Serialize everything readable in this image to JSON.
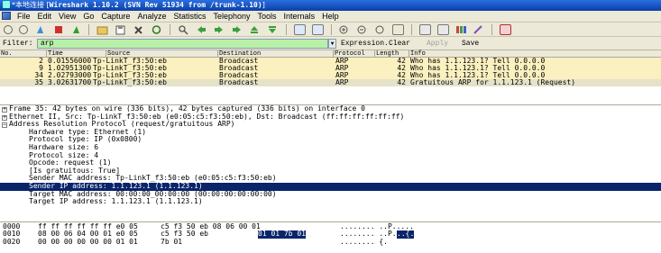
{
  "window": {
    "title": "Wireshark 1.10.2 (SVN Rev 51934 from /trunk-1.10)",
    "prefix": "*本地连接"
  },
  "menu": [
    "File",
    "Edit",
    "View",
    "Go",
    "Capture",
    "Analyze",
    "Statistics",
    "Telephony",
    "Tools",
    "Internals",
    "Help"
  ],
  "toolbar": {
    "icons": [
      "interface-list-icon",
      "capture-options-icon",
      "start-capture-icon",
      "stop-capture-icon",
      "restart-capture-icon",
      "open-file-icon",
      "save-file-icon",
      "close-file-icon",
      "reload-icon",
      "find-packet-icon",
      "go-back-icon",
      "go-forward-icon",
      "go-to-packet-icon",
      "go-first-icon",
      "go-last-icon",
      "colorize-icon",
      "auto-scroll-icon",
      "zoom-in-icon",
      "zoom-out-icon",
      "zoom-normal-icon",
      "resize-columns-icon",
      "capture-filters-icon",
      "display-filters-icon",
      "coloring-rules-icon",
      "preferences-icon",
      "help-icon"
    ]
  },
  "filter": {
    "label": "Filter:",
    "value": "arp",
    "expression": "Expression...",
    "clear": "Clear",
    "apply": "Apply",
    "save": "Save"
  },
  "packet_list": {
    "columns": [
      "No.",
      "Time",
      "Source",
      "Destination",
      "Protocol",
      "Length",
      "Info"
    ],
    "rows": [
      {
        "no": "2",
        "time": "0.01556000",
        "source": "Tp-LinkT_f3:50:eb",
        "destination": "Broadcast",
        "protocol": "ARP",
        "length": "42",
        "info": "Who has 1.1.123.1?  Tell 0.0.0.0"
      },
      {
        "no": "9",
        "time": "1.02951300",
        "source": "Tp-LinkT_f3:50:eb",
        "destination": "Broadcast",
        "protocol": "ARP",
        "length": "42",
        "info": "Who has 1.1.123.1?  Tell 0.0.0.0"
      },
      {
        "no": "34",
        "time": "2.02793000",
        "source": "Tp-LinkT_f3:50:eb",
        "destination": "Broadcast",
        "protocol": "ARP",
        "length": "42",
        "info": "Who has 1.1.123.1?  Tell 0.0.0.0"
      },
      {
        "no": "35",
        "time": "3.02631700",
        "source": "Tp-LinkT_f3:50:eb",
        "destination": "Broadcast",
        "protocol": "ARP",
        "length": "42",
        "info": "Gratuitous ARP for 1.1.123.1 (Request)"
      }
    ]
  },
  "details": {
    "frame": "Frame 35: 42 bytes on wire (336 bits), 42 bytes captured (336 bits) on interface 0",
    "ethernet": "Ethernet II, Src: Tp-LinkT_f3:50:eb (e0:05:c5:f3:50:eb), Dst: Broadcast (ff:ff:ff:ff:ff:ff)",
    "arp": "Address Resolution Protocol (request/gratuitous ARP)",
    "arp_fields": [
      "Hardware type: Ethernet (1)",
      "Protocol type: IP (0x0800)",
      "Hardware size: 6",
      "Protocol size: 4",
      "Opcode: request (1)",
      "[Is gratuitous: True]",
      "Sender MAC address: Tp-LinkT_f3:50:eb (e0:05:c5:f3:50:eb)",
      "Sender IP address: 1.1.123.1 (1.1.123.1)",
      "Target MAC address: 00:00:00_00:00:00 (00:00:00:00:00:00)",
      "Target IP address: 1.1.123.1 (1.1.123.1)"
    ]
  },
  "hex": {
    "rows": [
      {
        "offset": "0000",
        "bytes_a": "ff ff ff ff ff ff e0 05",
        "bytes_b": "c5 f3 50 eb 08 06 00 01",
        "bytes_hl": "",
        "ascii": "........ ..P.....",
        "ascii_hl": ""
      },
      {
        "offset": "0010",
        "bytes_a": "08 00 06 04 00 01 e0 05",
        "bytes_b": "c5 f3 50 eb",
        "bytes_hl": "01 01 7b 01",
        "ascii": "........ ..P.",
        "ascii_hl": "..{."
      },
      {
        "offset": "0020",
        "bytes_a": "00 00 00 00 00 00 01 01",
        "bytes_b": "7b 01",
        "bytes_hl": "",
        "ascii": "........ {.",
        "ascii_hl": ""
      }
    ]
  }
}
